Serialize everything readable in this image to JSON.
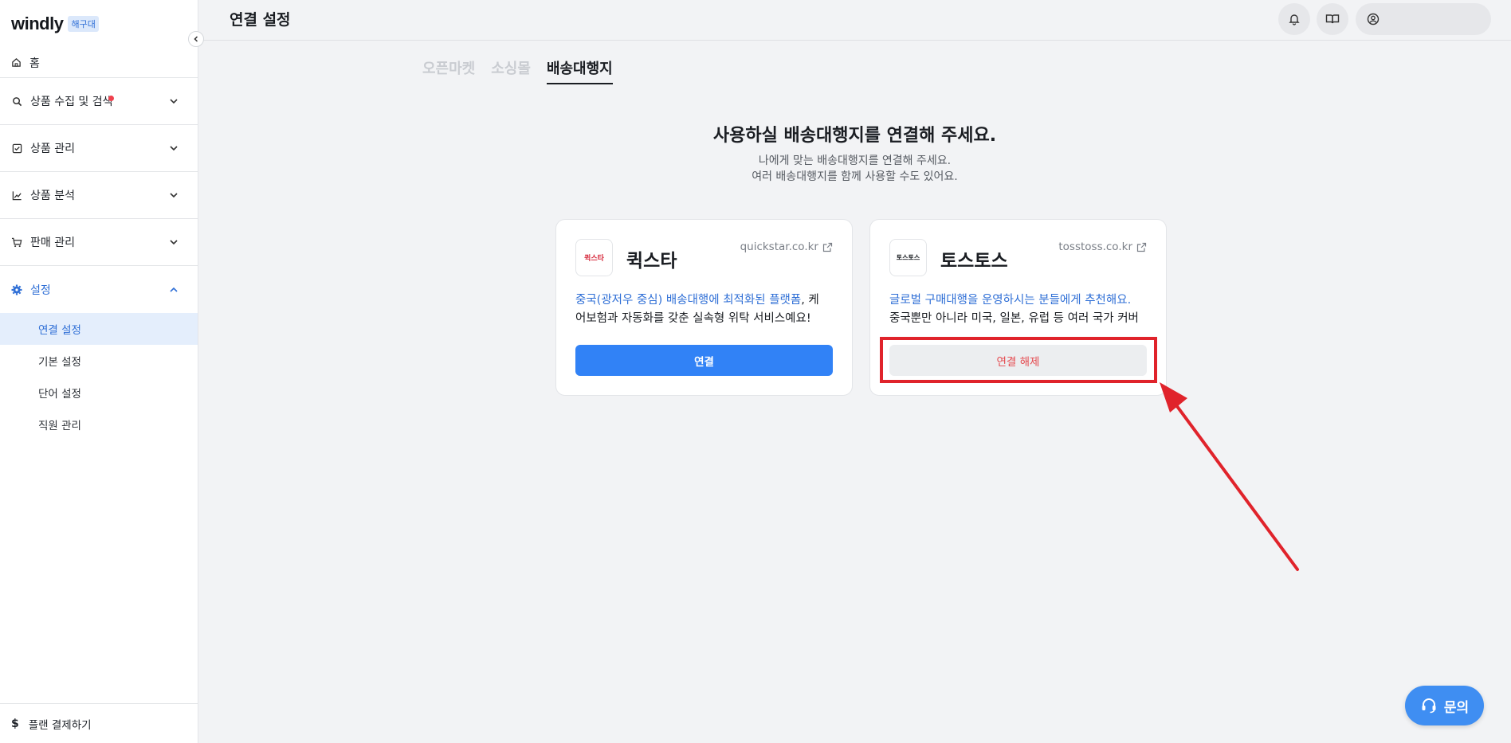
{
  "sidebar": {
    "logo": "windly",
    "logo_badge": "해구대",
    "home": "홈",
    "items": [
      {
        "label": "상품 수집 및 검색"
      },
      {
        "label": "상품 관리"
      },
      {
        "label": "상품 분석"
      },
      {
        "label": "판매 관리"
      },
      {
        "label": "설정"
      }
    ],
    "settings_sub": [
      {
        "label": "연결 설정"
      },
      {
        "label": "기본 설정"
      },
      {
        "label": "단어 설정"
      },
      {
        "label": "직원 관리"
      }
    ],
    "plan": "플랜 결제하기"
  },
  "header": {
    "title": "연결 설정"
  },
  "tabs": [
    {
      "label": "오픈마켓"
    },
    {
      "label": "소싱몰"
    },
    {
      "label": "배송대행지"
    }
  ],
  "main": {
    "title": "사용하실 배송대행지를 연결해 주세요.",
    "sub1": "나에게 맞는 배송대행지를 연결해 주세요.",
    "sub2": "여러 배송대행지를 함께 사용할 수도 있어요."
  },
  "cards": [
    {
      "logo_text": "퀵스타",
      "name": "퀵스타",
      "link": "quickstar.co.kr",
      "desc_hl": "중국(광저우 중심) 배송대행에 최적화된 플랫폼",
      "desc_rest": ", 케",
      "desc_line2": "어보험과 자동화를 갖춘 실속형 위탁 서비스예요!",
      "button": "연결"
    },
    {
      "logo_text": "토스토스",
      "name": "토스토스",
      "link": "tosstoss.co.kr",
      "desc_hl": "글로벌 구매대행을 운영하시는 분들에게 추천해요.",
      "desc_rest": "",
      "desc_line2": "중국뿐만 아니라 미국, 일본, 유럽 등 여러 국가 커버",
      "button": "연결 해제"
    }
  ],
  "help": {
    "label": "문의"
  },
  "colors": {
    "accent": "#3182f6",
    "annotation": "#e0232b",
    "danger": "#e5484d"
  }
}
